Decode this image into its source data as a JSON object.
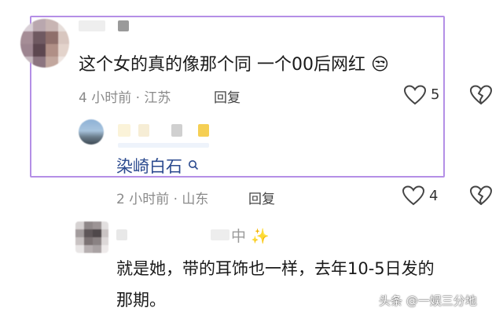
{
  "comment1": {
    "text": "这个女的真的像那个同 一个00后网红",
    "emoji": "😒",
    "meta": "4 小时前 · 江苏",
    "reply_label": "回复",
    "like_count": "5"
  },
  "reply1": {
    "mention": "染崎白石",
    "meta": "2 小时前 · 山东",
    "reply_label": "回复",
    "like_count": "4"
  },
  "comment2": {
    "name_suffix": "中",
    "sparkle": "✨",
    "text_line1": "就是她，带的耳饰也一样，去年10-5日发的",
    "text_line2": "那期。"
  },
  "watermark": {
    "text": "头条 @一娱三分地"
  },
  "colors": {
    "highlight_border": "#b48fe6",
    "mention": "#2b4a8f",
    "meta": "#8a8a8a"
  }
}
